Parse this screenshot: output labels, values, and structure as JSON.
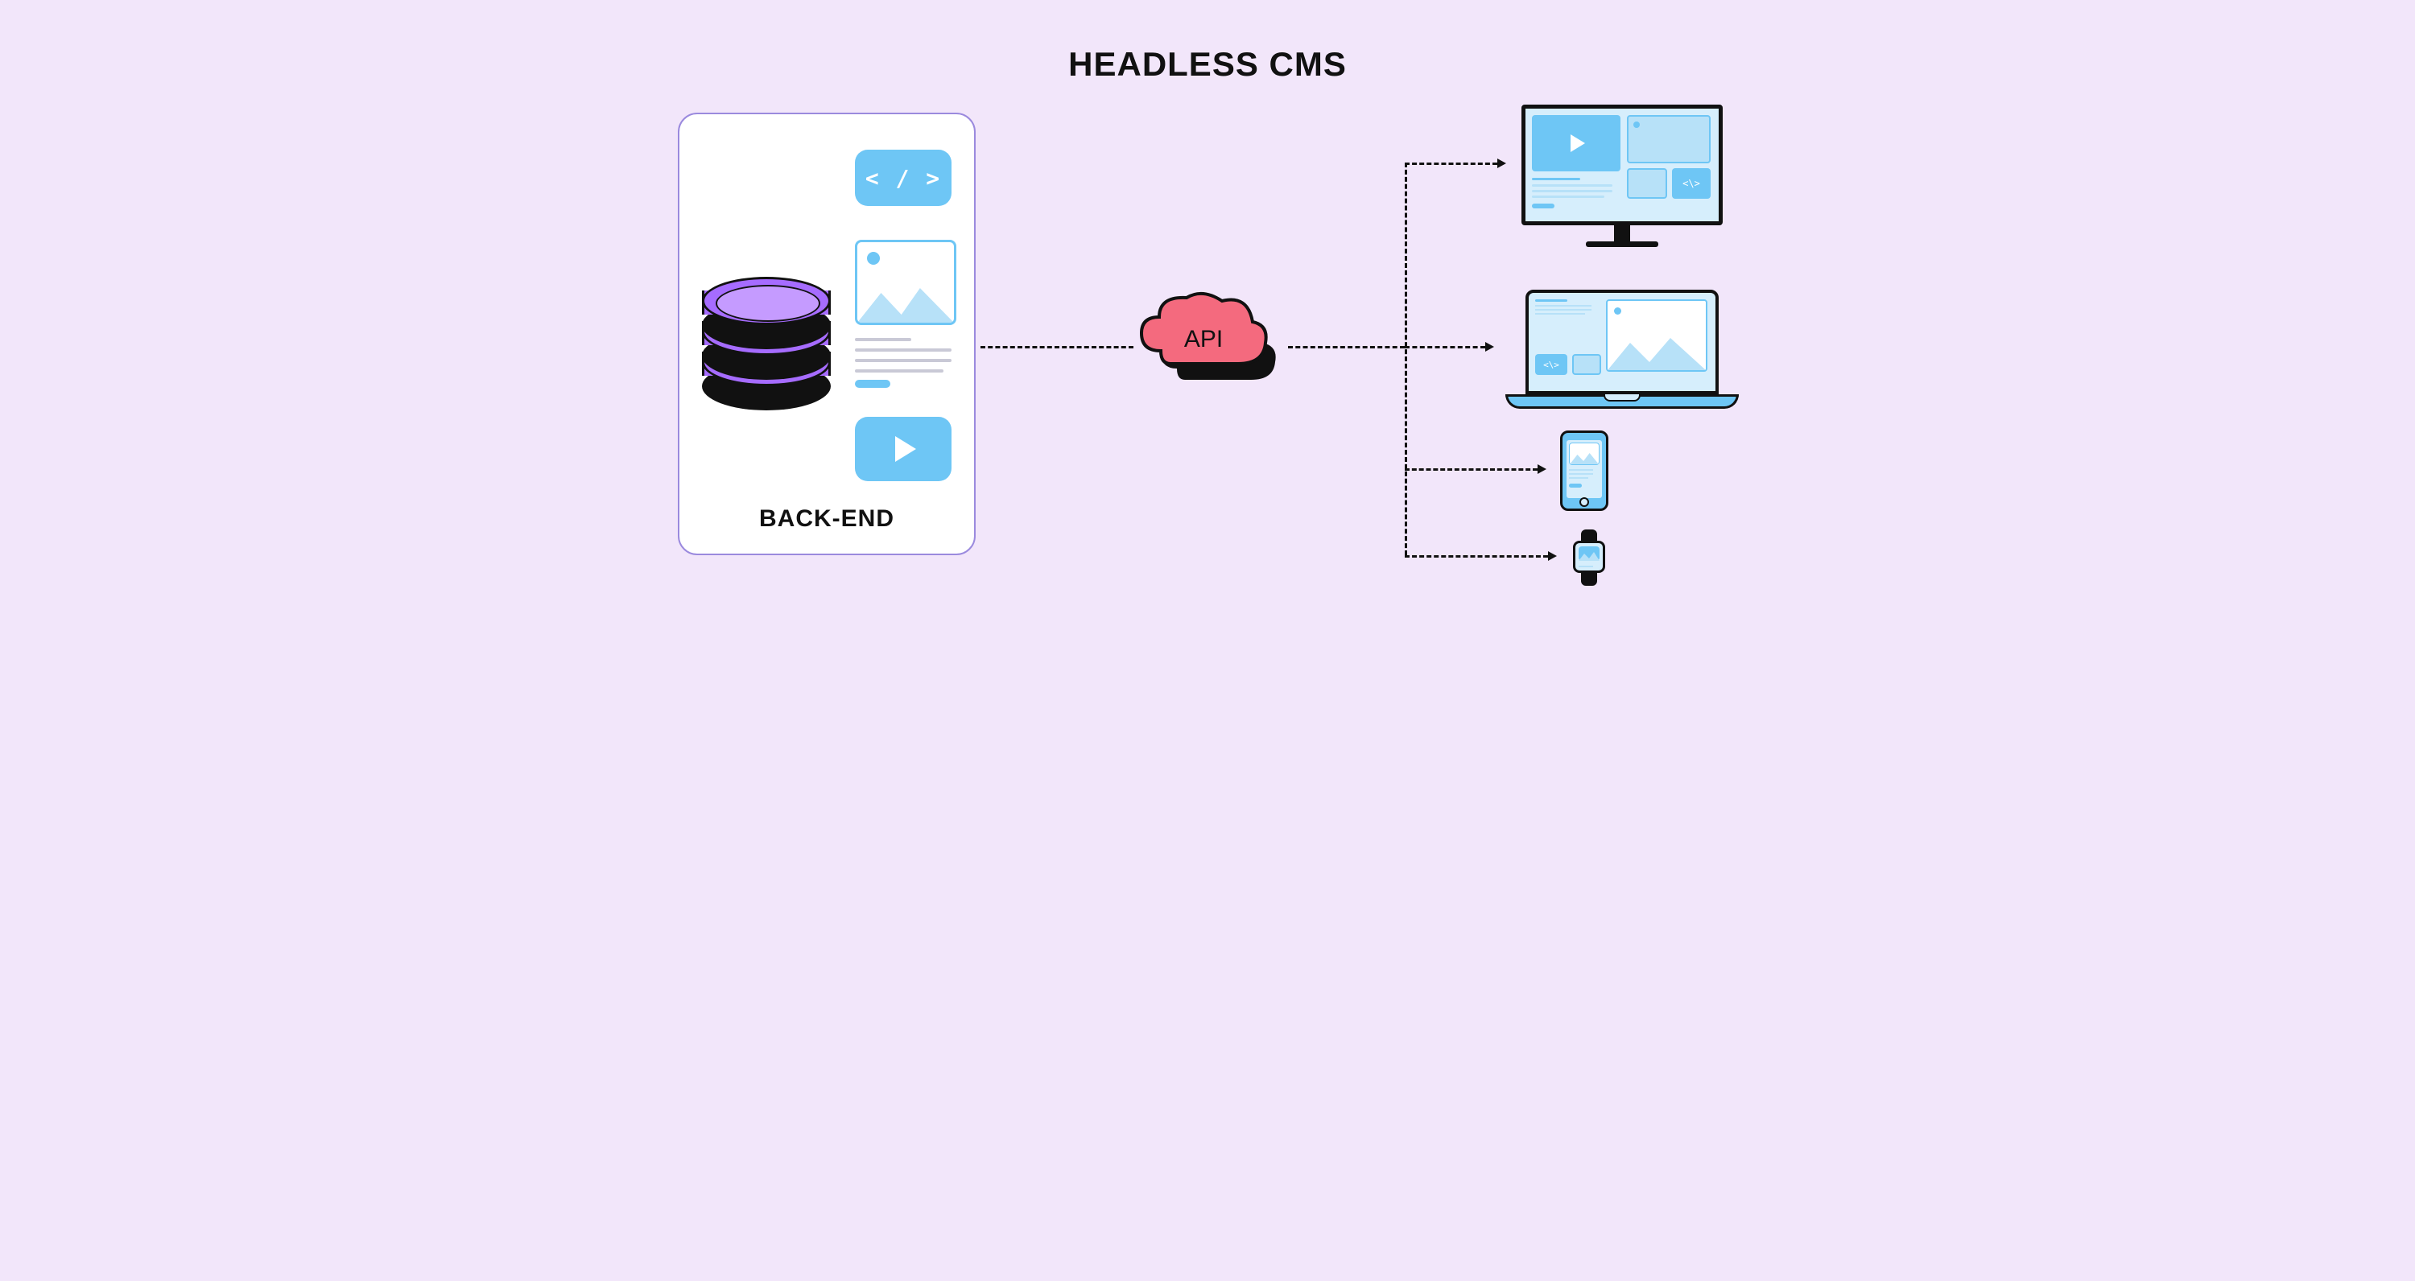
{
  "title": "HEADLESS CMS",
  "backend": {
    "label": "BACK-END",
    "tiles": {
      "code_symbol": "< / >"
    }
  },
  "api": {
    "label": "API"
  },
  "devices": {
    "desktop": "desktop-monitor",
    "laptop": "laptop",
    "phone": "smartphone",
    "watch": "smartwatch"
  },
  "colors": {
    "background": "#F2E6FA",
    "tile_blue": "#6EC6F5",
    "tile_light": "#D6EEFC",
    "db_purple": "#A66CFF",
    "api_pink": "#F46A7E"
  }
}
